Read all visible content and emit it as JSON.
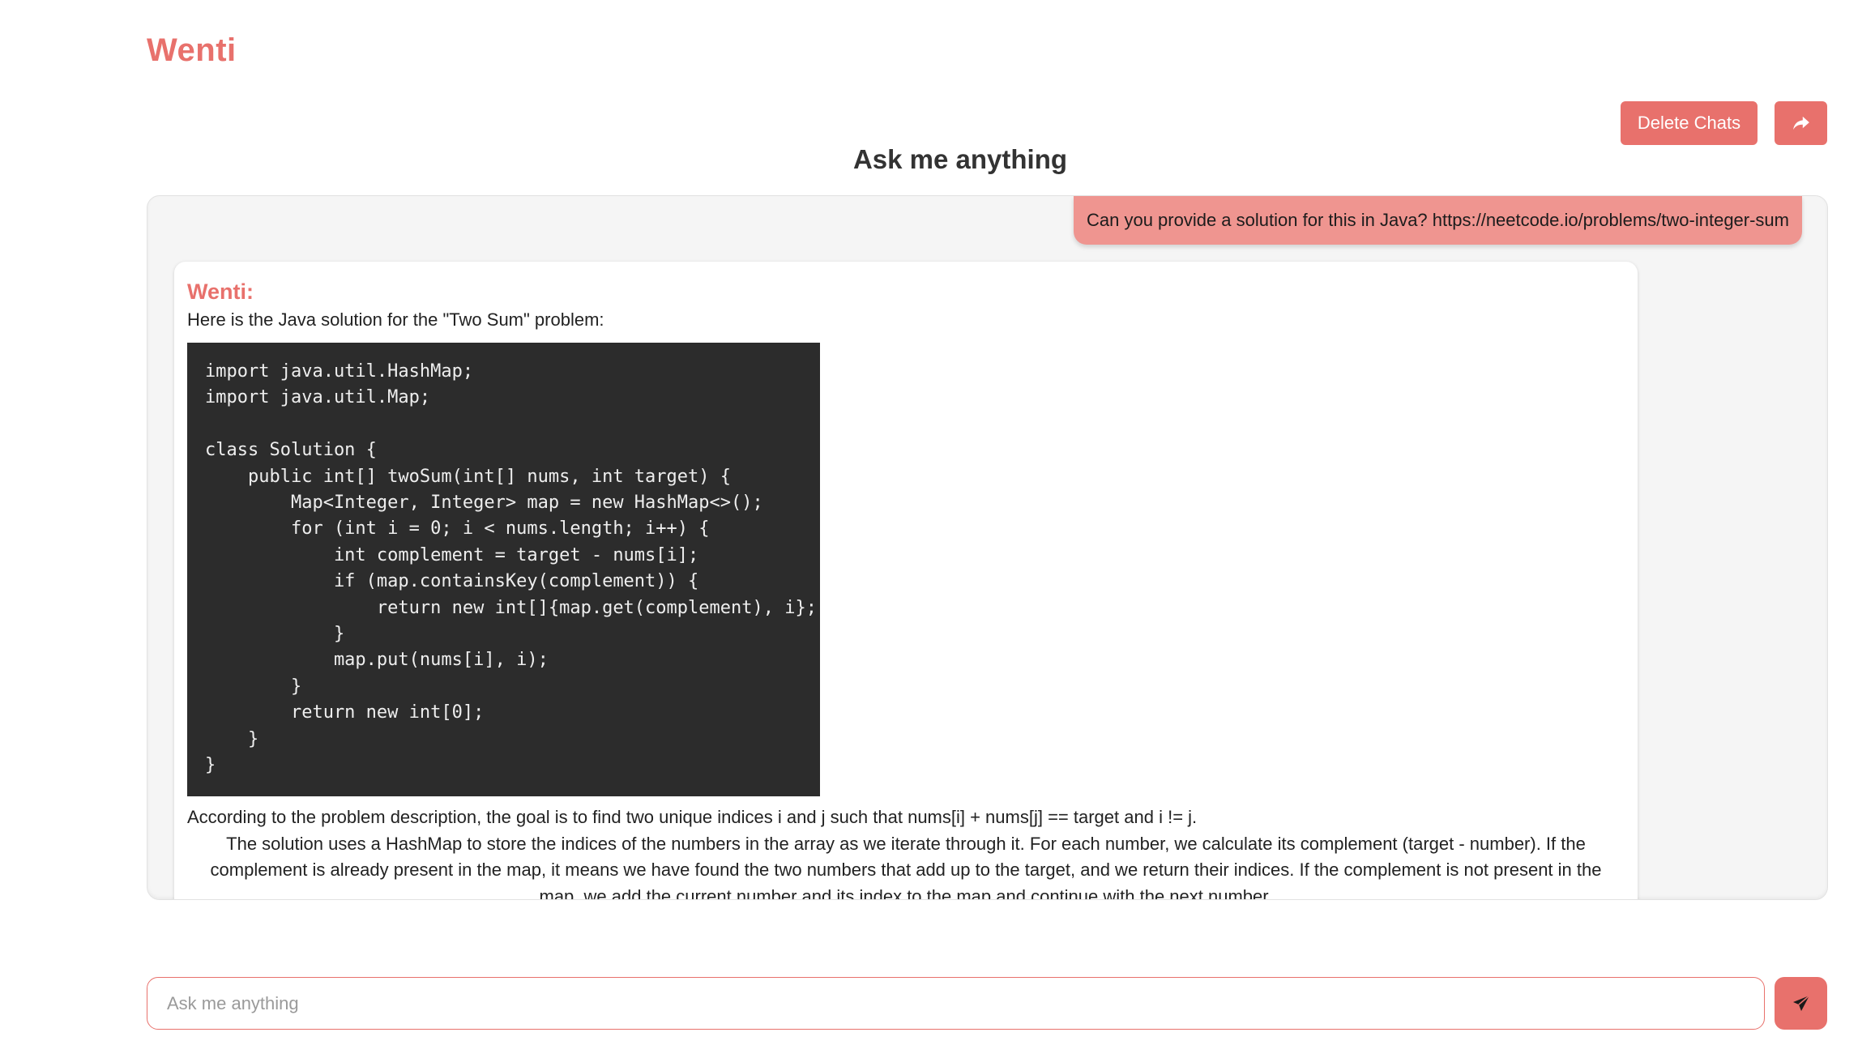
{
  "app": {
    "brand": "Wenti",
    "title": "Ask me anything"
  },
  "toolbar": {
    "delete_label": "Delete Chats",
    "share_icon": "share-arrow-icon"
  },
  "chat": {
    "user_message": "Can you provide a solution for this in Java? https://neetcode.io/problems/two-integer-sum",
    "bot_name": "Wenti:",
    "bot_intro": "Here is the Java solution for the \"Two Sum\" problem:",
    "code": "import java.util.HashMap;\nimport java.util.Map;\n\nclass Solution {\n    public int[] twoSum(int[] nums, int target) {\n        Map<Integer, Integer> map = new HashMap<>();\n        for (int i = 0; i < nums.length; i++) {\n            int complement = target - nums[i];\n            if (map.containsKey(complement)) {\n                return new int[]{map.get(complement), i};\n            }\n            map.put(nums[i], i);\n        }\n        return new int[0];\n    }\n}",
    "paragraph_1": "According to the problem description, the goal is to find two unique indices i and j such that nums[i] + nums[j] == target and i != j.",
    "paragraph_2": "The solution uses a HashMap to store the indices of the numbers in the array as we iterate through it. For each number, we calculate its complement (target - number). If the complement is already present in the map, it means we have found the two numbers that add up to the target, and we return their indices. If the complement is not present in the map, we add the current number and its index to the map and continue with the next number."
  },
  "composer": {
    "placeholder": "Ask me anything",
    "value": "",
    "send_icon": "paper-plane-icon"
  },
  "colors": {
    "accent": "#e8716c",
    "user_bubble": "#ef9590",
    "code_bg": "#2c2c2c"
  }
}
